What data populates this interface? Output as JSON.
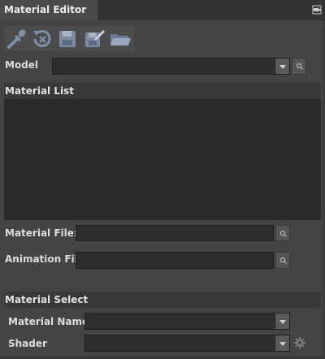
{
  "window": {
    "title": "Material Editor"
  },
  "toolbar": {
    "tools": [
      {
        "icon": "eyedropper-icon"
      },
      {
        "icon": "reset-icon"
      },
      {
        "icon": "save-icon"
      },
      {
        "icon": "save-as-icon"
      },
      {
        "icon": "open-folder-icon"
      }
    ]
  },
  "model": {
    "label": "Model",
    "value": ""
  },
  "material_list": {
    "title": "Material List",
    "items": []
  },
  "material_file": {
    "label": "Material File:",
    "value": ""
  },
  "animation_file": {
    "label": "Animation File:",
    "value": ""
  },
  "material_select": {
    "title": "Material Select",
    "material_name": {
      "label": "Material Name",
      "value": ""
    },
    "shader": {
      "label": "Shader",
      "value": ""
    }
  }
}
